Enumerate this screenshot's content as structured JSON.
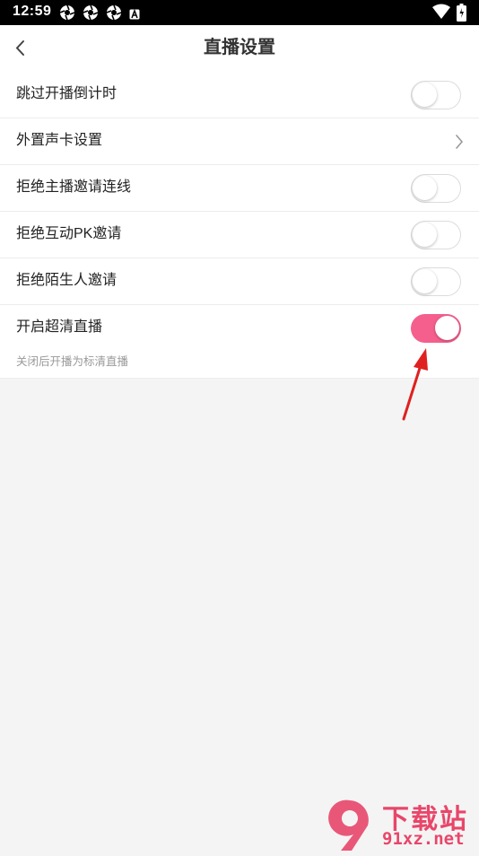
{
  "status_bar": {
    "time": "12:59",
    "icons": [
      "aperture-icon",
      "aperture-icon",
      "aperture-icon",
      "a-notification-icon"
    ],
    "right_icons": [
      "wifi-icon",
      "battery-icon"
    ]
  },
  "header": {
    "title": "直播设置",
    "back_icon": "chevron-left-icon"
  },
  "settings": [
    {
      "label": "跳过开播倒计时",
      "control": "toggle",
      "on": false
    },
    {
      "label": "外置声卡设置",
      "control": "chevron"
    },
    {
      "label": "拒绝主播邀请连线",
      "control": "toggle",
      "on": false
    },
    {
      "label": "拒绝互动PK邀请",
      "control": "toggle",
      "on": false
    },
    {
      "label": "拒绝陌生人邀请",
      "control": "toggle",
      "on": false
    },
    {
      "label": "开启超清直播",
      "control": "toggle",
      "on": true,
      "hint": "关闭后开播为标清直播"
    }
  ],
  "annotation": {
    "icon": "red-arrow-icon",
    "color": "#e02020"
  },
  "watermark": {
    "line1": "下载站",
    "line2": "91xz.net",
    "logo": "9-logo-icon"
  },
  "colors": {
    "accent": "#f55f8d",
    "background": "#f4f4f4"
  }
}
